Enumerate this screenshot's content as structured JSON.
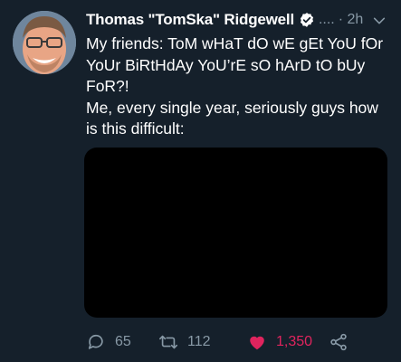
{
  "tweet": {
    "author_name": "Thomas \"TomSka\" Ridgewell",
    "handle_truncated": "....",
    "timestamp": "· 2h",
    "text_line1": "My friends: ToM wHaT dO wE gEt YoU fOr YoUr BiRtHdAy YoU’rE sO hArD tO bUy FoR?!",
    "text_line2": "Me, every single year, seriously guys how is this difficult:",
    "media": "black-video-frame"
  },
  "actions": {
    "replies": "65",
    "retweets": "112",
    "likes": "1,350"
  },
  "colors": {
    "background": "#15202b",
    "secondary_text": "#8899a6",
    "like_active": "#e0245e"
  },
  "icons": {
    "verified": "verified-badge-icon",
    "caret": "chevron-down-icon",
    "reply": "reply-icon",
    "retweet": "retweet-icon",
    "like": "heart-icon",
    "share": "share-icon"
  }
}
